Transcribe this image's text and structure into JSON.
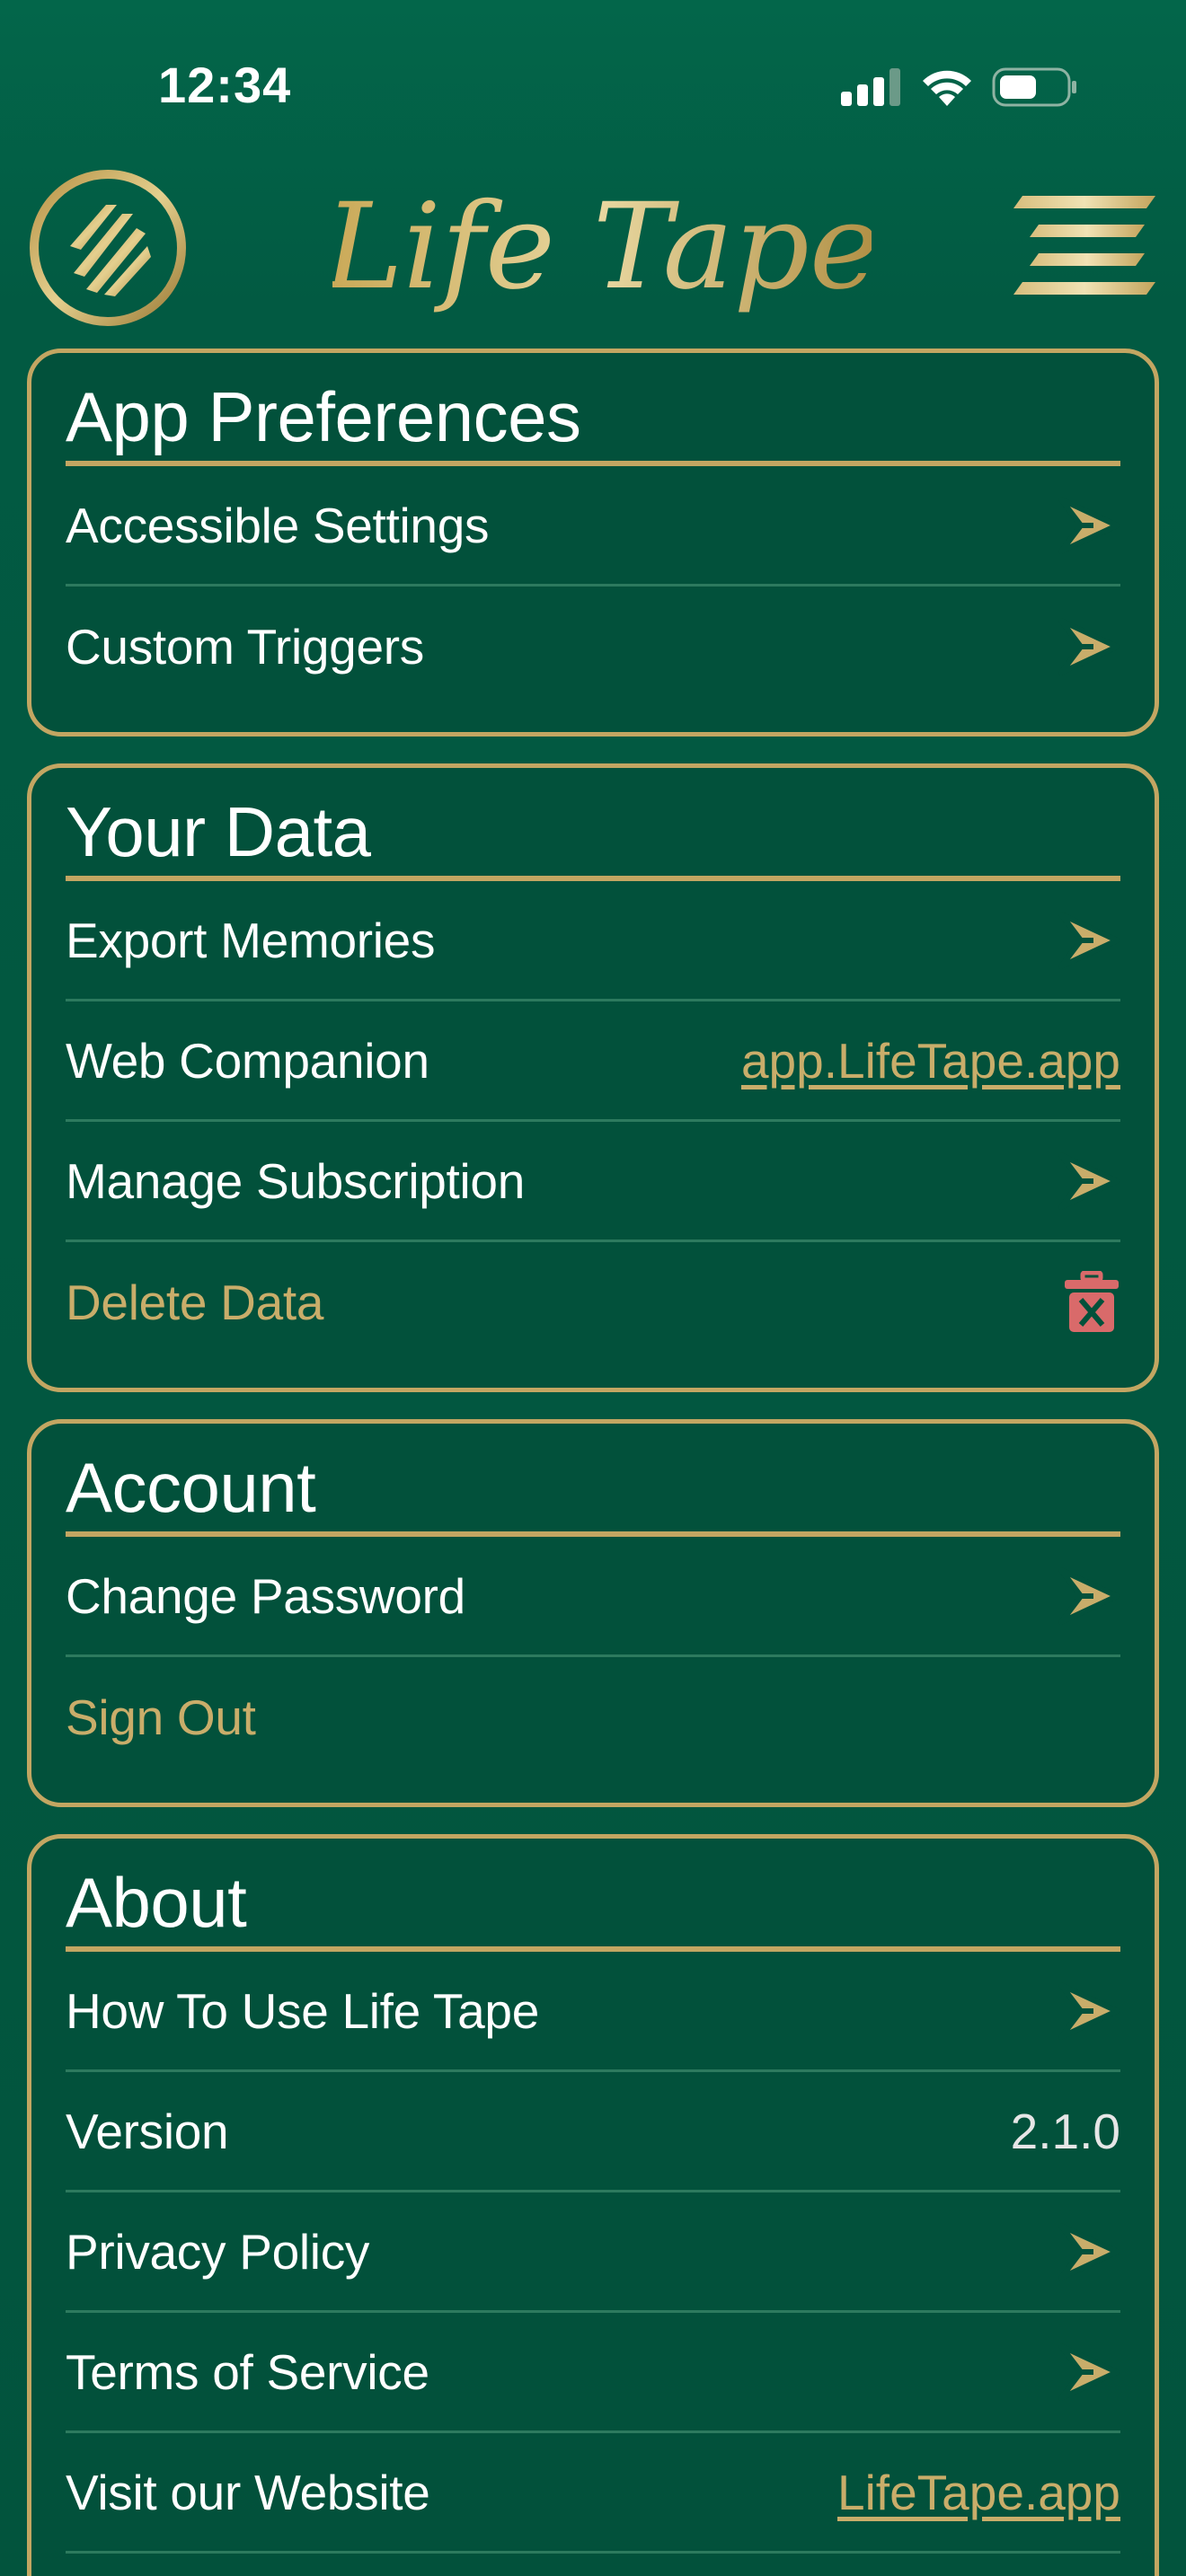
{
  "status": {
    "time": "12:34"
  },
  "header": {
    "brand_name": "Life Tape"
  },
  "sections": {
    "prefs": {
      "title": "App Preferences",
      "accessible": "Accessible Settings",
      "triggers": "Custom Triggers"
    },
    "data": {
      "title": "Your Data",
      "export": "Export Memories",
      "web_companion": "Web Companion",
      "web_companion_link": "app.LifeTape.app",
      "subscription": "Manage Subscription",
      "delete": "Delete Data"
    },
    "account": {
      "title": "Account",
      "change_password": "Change Password",
      "sign_out": "Sign Out"
    },
    "about": {
      "title": "About",
      "how_to": "How To Use Life Tape",
      "version_label": "Version",
      "version_value": "2.1.0",
      "privacy": "Privacy Policy",
      "terms": "Terms of Service",
      "website": "Visit our Website",
      "website_link": "LifeTape.app"
    }
  },
  "colors": {
    "background": "#02543d",
    "gold": "#c3a662",
    "delete_icon": "#d96a6a",
    "divider": "#2d7a5e"
  },
  "icons": {
    "chevron": "gold-arrow-right-icon",
    "delete": "trash-icon",
    "logo": "striped-circle-logo-icon",
    "menu": "hamburger-menu-icon"
  }
}
